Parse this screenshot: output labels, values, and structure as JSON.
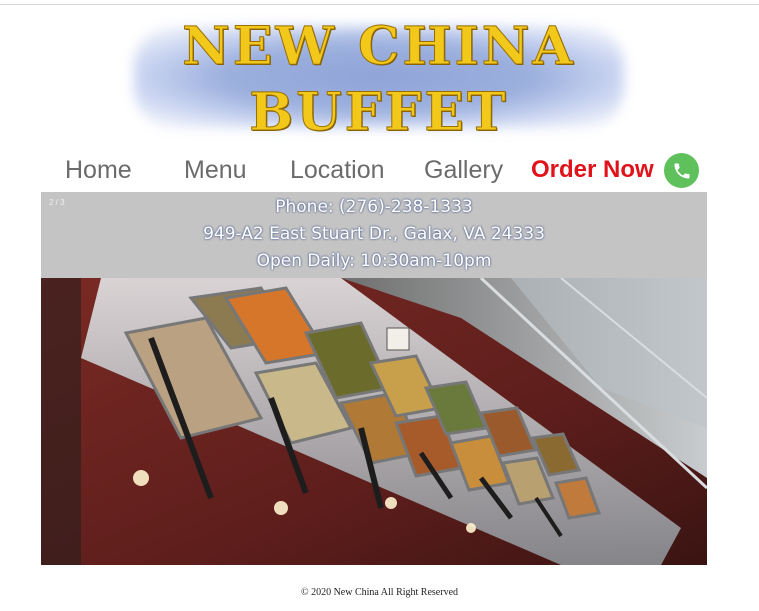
{
  "banner": {
    "line1": "NEW CHINA",
    "line2": "BUFFET"
  },
  "nav": {
    "home": "Home",
    "menu": "Menu",
    "location": "Location",
    "gallery": "Gallery",
    "order": "Order Now",
    "order_icon": "phone-icon"
  },
  "slideshow": {
    "counter": "2 / 3",
    "phone": "Phone: (276)-238-1333",
    "address": "949-A2 East Stuart Dr., Galax, VA 24333",
    "hours": "Open Daily: 10:30am-10pm"
  },
  "footer": {
    "copyright": "© 2020 New China All Right Reserved"
  },
  "colors": {
    "order_red": "#e0121a",
    "phone_green": "#5fc15b",
    "banner_gold": "#f2c81b",
    "banner_blue": "#8fa3d8",
    "info_grey": "#c4c4c4"
  }
}
